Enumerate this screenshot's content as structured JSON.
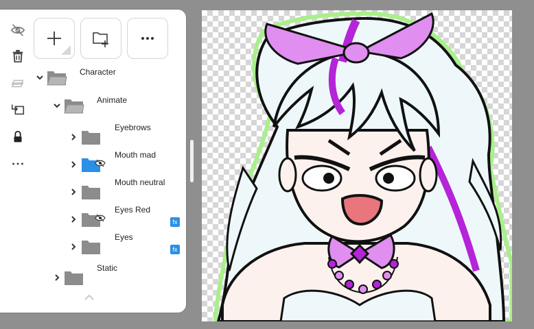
{
  "toolbar": {
    "tools": [
      {
        "name": "hide-eye-icon"
      },
      {
        "name": "trash-icon"
      },
      {
        "name": "merge-layers-icon"
      },
      {
        "name": "move-layer-icon"
      },
      {
        "name": "lock-icon"
      },
      {
        "name": "more-icon"
      }
    ],
    "top_buttons": [
      {
        "name": "add-layer-button",
        "icon": "plus-icon"
      },
      {
        "name": "new-folder-button",
        "icon": "folder-plus-icon"
      },
      {
        "name": "more-options-button",
        "icon": "ellipsis-icon"
      }
    ]
  },
  "layers": [
    {
      "label": "Character",
      "depth": 0,
      "expanded": true,
      "hidden": false,
      "fx": false,
      "color": "#8c8c8c"
    },
    {
      "label": "Animate",
      "depth": 1,
      "expanded": true,
      "hidden": false,
      "fx": false,
      "color": "#8c8c8c"
    },
    {
      "label": "Eyebrows",
      "depth": 2,
      "expanded": false,
      "hidden": false,
      "fx": false,
      "color": "#8c8c8c"
    },
    {
      "label": "Mouth mad",
      "depth": 2,
      "expanded": false,
      "hidden": true,
      "fx": false,
      "color": "#2b8fe6"
    },
    {
      "label": "Mouth neutral",
      "depth": 2,
      "expanded": false,
      "hidden": false,
      "fx": false,
      "color": "#8c8c8c"
    },
    {
      "label": "Eyes Red",
      "depth": 2,
      "expanded": false,
      "hidden": true,
      "fx": true,
      "color": "#8c8c8c"
    },
    {
      "label": "Eyes",
      "depth": 2,
      "expanded": false,
      "hidden": false,
      "fx": true,
      "color": "#8c8c8c"
    },
    {
      "label": "Static",
      "depth": 1,
      "expanded": false,
      "hidden": false,
      "fx": false,
      "color": "#8c8c8c"
    }
  ],
  "fx_label": "fx",
  "colors": {
    "accent": "#2b8fe6",
    "folder_gray": "#8c8c8c",
    "hair": "#eef8fb",
    "ribbon": "#e08ef0",
    "streak": "#b524d8",
    "outline_glow": "#a8f08a",
    "skin": "#fdf1ee",
    "mouth": "#e9767c"
  }
}
